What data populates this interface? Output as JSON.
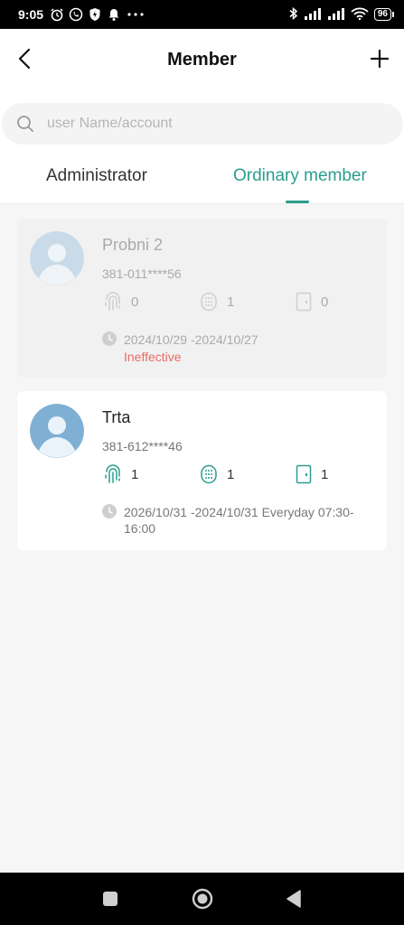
{
  "status_bar": {
    "time": "9:05",
    "battery": "96"
  },
  "header": {
    "title": "Member"
  },
  "search": {
    "placeholder": "user Name/account",
    "value": ""
  },
  "tabs": [
    {
      "label": "Administrator",
      "active": false
    },
    {
      "label": "Ordinary member",
      "active": true
    }
  ],
  "members": [
    {
      "name": "Probni 2",
      "account": "381-011****56",
      "fingerprint_count": "0",
      "card_count": "1",
      "door_count": "0",
      "validity": "2024/10/29 -2024/10/27",
      "status": "Ineffective",
      "active": false
    },
    {
      "name": "Trta",
      "account": "381-612****46",
      "fingerprint_count": "1",
      "card_count": "1",
      "door_count": "1",
      "validity": "2026/10/31 -2024/10/31 Everyday 07:30-16:00",
      "status": "",
      "active": true
    }
  ],
  "colors": {
    "accent": "#2a9d8f",
    "inactive_icon": "#cfcfcf",
    "error": "#ea6b66"
  },
  "icons": [
    "back-arrow-icon",
    "plus-icon",
    "search-icon",
    "fingerprint-icon",
    "card-icon",
    "door-icon",
    "clock-icon"
  ]
}
